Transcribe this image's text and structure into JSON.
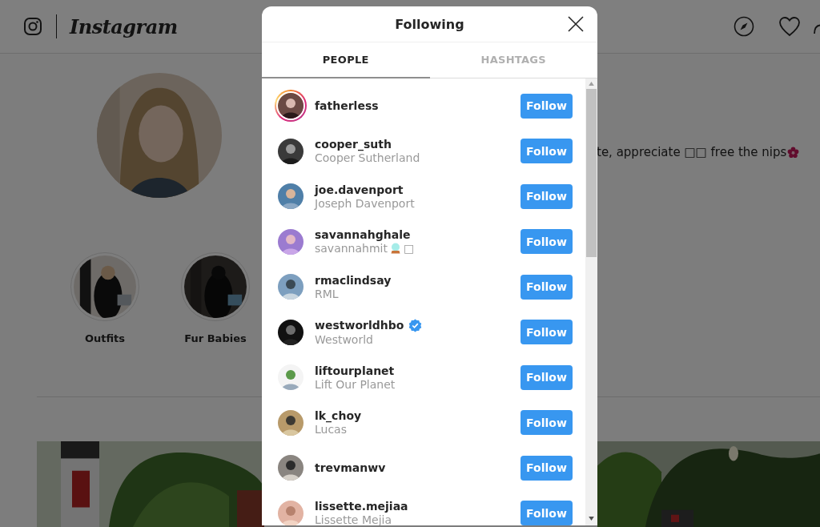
{
  "header": {
    "logo": "Instagram"
  },
  "profile": {
    "bio": "te, appreciate □□ free the nips"
  },
  "highlights": [
    {
      "label": "Outfits"
    },
    {
      "label": "Fur Babies"
    }
  ],
  "dialog": {
    "title": "Following",
    "tabs": [
      {
        "label": "PEOPLE",
        "selected": true
      },
      {
        "label": "HASHTAGS",
        "selected": false
      }
    ],
    "users": [
      {
        "username": "fatherless",
        "has_story": true,
        "verified": false,
        "button": "Follow"
      },
      {
        "username": "cooper_suth",
        "full_name": "Cooper Sutherland",
        "has_story": false,
        "verified": false,
        "button": "Follow"
      },
      {
        "username": "joe.davenport",
        "full_name": "Joseph Davenport",
        "has_story": false,
        "verified": false,
        "button": "Follow"
      },
      {
        "username": "savannahghale",
        "full_name": "savannahmit",
        "emoji": true,
        "name_suffix": "□",
        "has_story": false,
        "verified": false,
        "button": "Follow"
      },
      {
        "username": "rmaclindsay",
        "full_name": "RML",
        "has_story": false,
        "verified": false,
        "button": "Follow"
      },
      {
        "username": "westworldhbo",
        "full_name": "Westworld",
        "has_story": false,
        "verified": true,
        "button": "Follow"
      },
      {
        "username": "liftourplanet",
        "full_name": "Lift Our Planet",
        "has_story": false,
        "verified": false,
        "button": "Follow"
      },
      {
        "username": "lk_choy",
        "full_name": "Lucas",
        "has_story": false,
        "verified": false,
        "button": "Follow"
      },
      {
        "username": "trevmanwv",
        "has_story": false,
        "verified": false,
        "button": "Follow"
      },
      {
        "username": "lissette.mejiaa",
        "full_name": "Lissette Mejia",
        "has_story": false,
        "verified": false,
        "button": "Follow"
      }
    ]
  }
}
